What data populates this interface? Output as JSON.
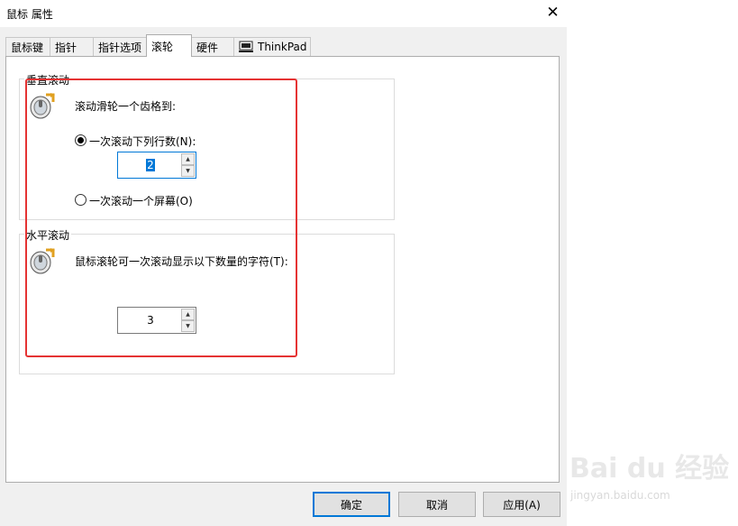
{
  "window": {
    "title": "鼠标 属性",
    "close_glyph": "✕"
  },
  "tabs": [
    {
      "label": "鼠标键"
    },
    {
      "label": "指针"
    },
    {
      "label": "指针选项"
    },
    {
      "label": "滚轮",
      "active": true
    },
    {
      "label": "硬件"
    },
    {
      "label": "ThinkPad",
      "icon": "thinkpad-icon"
    }
  ],
  "vertical": {
    "group_label": "垂直滚动",
    "prompt": "滚动滑轮一个齿格到:",
    "option_lines": "一次滚动下列行数(N):",
    "lines_value": "2",
    "option_screen": "一次滚动一个屏幕(O)",
    "selected": "lines",
    "icon": "mouse-wheel-icon"
  },
  "horizontal": {
    "group_label": "水平滚动",
    "prompt": "鼠标滚轮可一次滚动显示以下数量的字符(T):",
    "chars_value": "3",
    "icon": "mouse-wheel-icon"
  },
  "spin_glyphs": {
    "up": "▲",
    "down": "▼"
  },
  "buttons": {
    "ok": "确定",
    "cancel": "取消",
    "apply": "应用(A)"
  },
  "watermark": {
    "brand": "Bai du 经验",
    "url": "jingyan.baidu.com"
  },
  "colors": {
    "highlight": "#e53333",
    "accent": "#0078d7",
    "dialog_bg": "#f0f0f0"
  }
}
